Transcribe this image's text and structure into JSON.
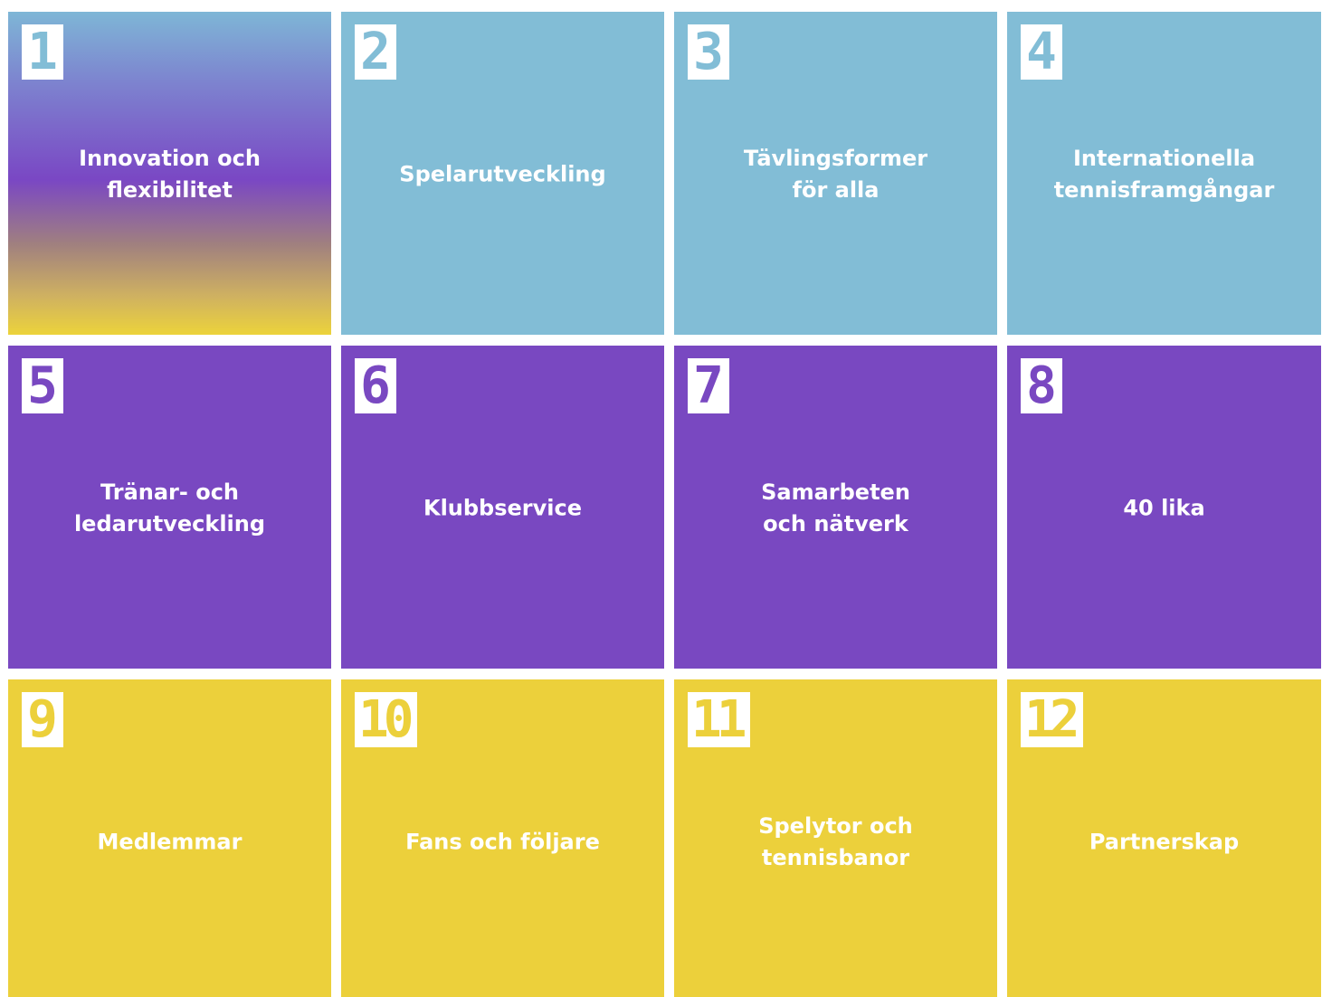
{
  "tiles": [
    {
      "number": "1",
      "label": "Innovation och\nflexibilitet",
      "color": "gradient"
    },
    {
      "number": "2",
      "label": "Spelarutveckling",
      "color": "#82bdd6"
    },
    {
      "number": "3",
      "label": "Tävlingsformer\nför alla",
      "color": "#82bdd6"
    },
    {
      "number": "4",
      "label": "Internationella\ntennisframgångar",
      "color": "#82bdd6"
    },
    {
      "number": "5",
      "label": "Tränar- och\nledarutveckling",
      "color": "#7948c1"
    },
    {
      "number": "6",
      "label": "Klubbservice",
      "color": "#7948c1"
    },
    {
      "number": "7",
      "label": "Samarbeten\noch nätverk",
      "color": "#7948c1"
    },
    {
      "number": "8",
      "label": "40 lika",
      "color": "#7948c1"
    },
    {
      "number": "9",
      "label": "Medlemmar",
      "color": "#ecd03b"
    },
    {
      "number": "10",
      "label": "Fans och följare",
      "color": "#ecd03b"
    },
    {
      "number": "11",
      "label": "Spelytor och\ntennisbanor",
      "color": "#ecd03b"
    },
    {
      "number": "12",
      "label": "Partnerskap",
      "color": "#ecd03b"
    }
  ],
  "colors": {
    "blue": "#82bdd6",
    "purple": "#7948c1",
    "yellow": "#ecd03b",
    "text": "#ffffff",
    "badge_background": "#ffffff"
  }
}
